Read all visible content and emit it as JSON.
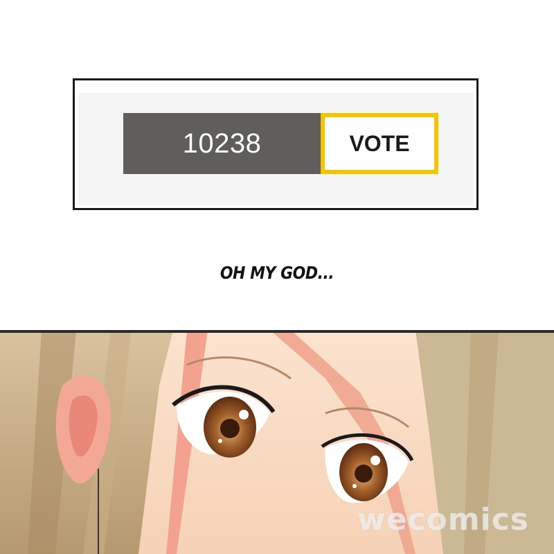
{
  "vote_widget": {
    "count": "10238",
    "button_label": "VOTE",
    "count_bg_color": "#5f5e5c",
    "button_border_color": "#f2c500"
  },
  "caption": {
    "text": "OH MY GOD..."
  },
  "illustration": {
    "watermark": "wecomics",
    "subject": "anime-girl-eyes-closeup"
  }
}
